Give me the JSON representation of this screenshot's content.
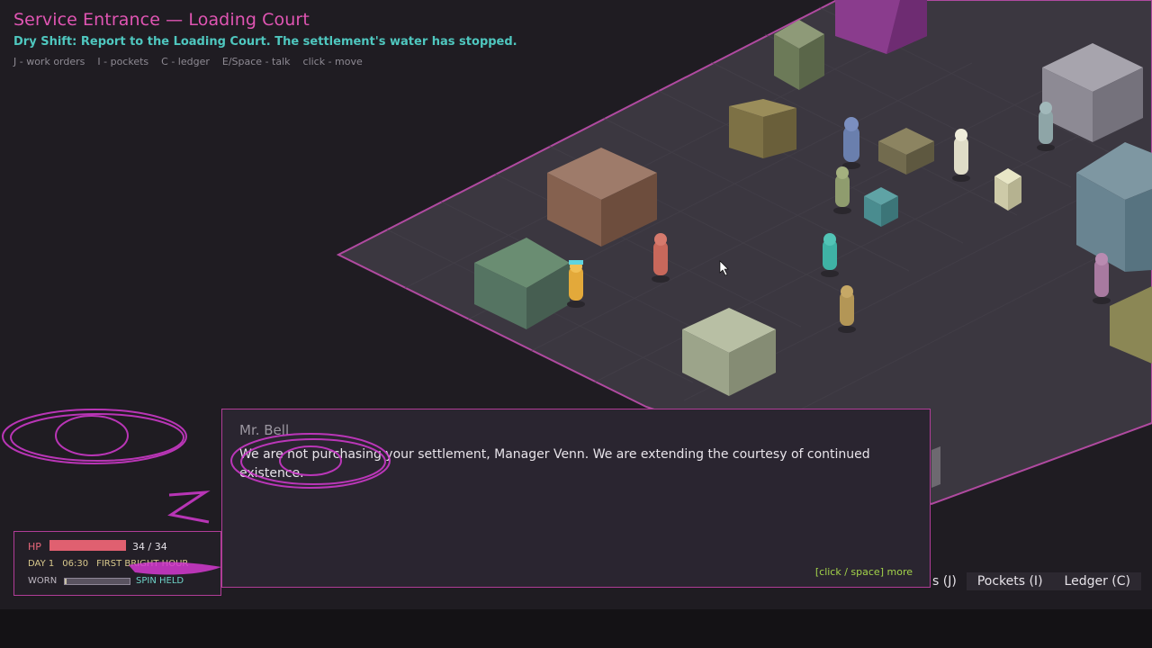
{
  "hud": {
    "area_title": "Service Entrance — Loading Court",
    "objective": "Dry Shift: Report to the Loading Court. The settlement's water has stopped.",
    "hints": [
      "J - work orders",
      "I - pockets",
      "C - ledger",
      "E/Space - talk",
      "click - move"
    ]
  },
  "dialogue": {
    "speaker": "Mr. Bell",
    "line": "We are not purchasing your settlement, Manager Venn. We are extending the courtesy of continued existence.",
    "continue_key": "[click / space]",
    "continue_label": "more"
  },
  "tabs": {
    "partial": "s (J)",
    "pockets": "Pockets (I)",
    "ledger": "Ledger (C)"
  },
  "status": {
    "hp_label": "HP",
    "hp_value": "34 / 34",
    "hp_fraction": 1.0,
    "day": "DAY 1",
    "time": "06:30",
    "period": "FIRST BRIGHT HOUR",
    "worn_label": "WORN",
    "worn_fraction": 0.02,
    "worn_text": "SPIN HELD"
  },
  "colors": {
    "accent_magenta": "#e055b3",
    "objective_teal": "#4fc7bf",
    "hp_red": "#e06070",
    "panel_border": "#b03d97"
  }
}
